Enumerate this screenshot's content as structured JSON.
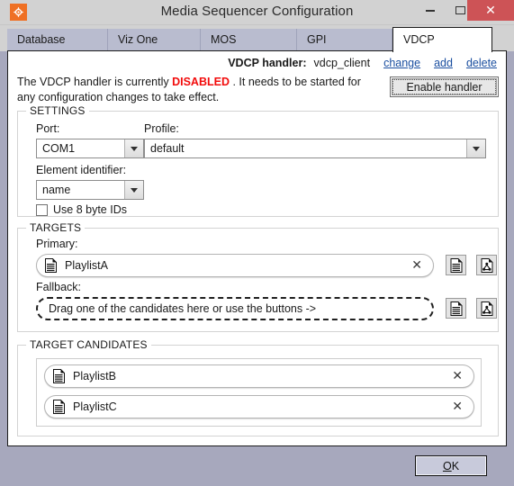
{
  "window": {
    "title": "Media Sequencer Configuration",
    "app_icon": "app-logo-icon",
    "controls": {
      "minimize": "minimize-icon",
      "maximize": "maximize-icon",
      "close": "close-icon"
    }
  },
  "tabs": [
    {
      "label": "Database",
      "selected": false
    },
    {
      "label": "Viz One",
      "selected": false
    },
    {
      "label": "MOS",
      "selected": false
    },
    {
      "label": "GPI",
      "selected": false
    },
    {
      "label": "VDCP",
      "selected": true
    }
  ],
  "handler": {
    "label": "VDCP handler:",
    "value": "vdcp_client",
    "links": [
      {
        "label": "change"
      },
      {
        "label": "add"
      },
      {
        "label": "delete"
      }
    ],
    "enable_button": "Enable handler"
  },
  "status": {
    "prefix": "The VDCP handler is currently ",
    "state": "DISABLED",
    "suffix": " . It needs to be started for any configuration  changes to take effect.",
    "state_color": "#f20d0d"
  },
  "settings": {
    "group_title": "SETTINGS",
    "port": {
      "label": "Port:",
      "value": "COM1"
    },
    "profile": {
      "label": "Profile:",
      "value": "default"
    },
    "element_identifier": {
      "label": "Element identifier:",
      "value": "name"
    },
    "use_8_byte_ids": {
      "label": "Use 8 byte IDs",
      "checked": false
    }
  },
  "targets": {
    "group_title": "TARGETS",
    "primary": {
      "label": "Primary:",
      "value": "PlaylistA",
      "clear": "✕"
    },
    "fallback": {
      "label": "Fallback:",
      "placeholder": "Drag one of the candidates here or use the buttons ->"
    },
    "buttons": {
      "playlist": "playlist-page-icon",
      "group": "group-page-icon"
    }
  },
  "candidates": {
    "group_title": "TARGET CANDIDATES",
    "items": [
      {
        "label": "PlaylistB",
        "clear": "✕"
      },
      {
        "label": "PlaylistC",
        "clear": "✕"
      }
    ]
  },
  "footer": {
    "ok_accel": "O",
    "ok_rest": "K"
  }
}
